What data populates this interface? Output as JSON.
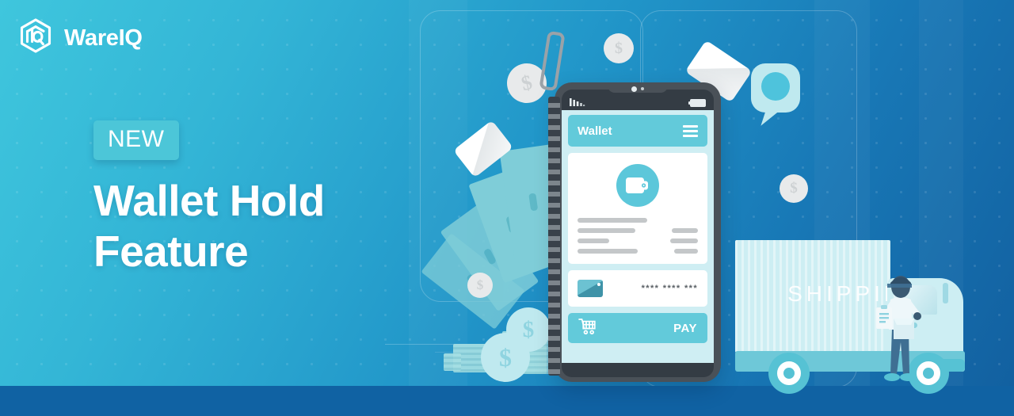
{
  "brand": {
    "name": "WareIQ",
    "logo_icon": "cube-hexagon-logo-icon"
  },
  "hero": {
    "badge": "NEW",
    "title_line1": "Wallet Hold",
    "title_line2": "Feature"
  },
  "phone": {
    "status": {
      "signal_icon": "signal-bars-icon",
      "battery_icon": "battery-icon",
      "camera_icon": "front-camera-icon"
    },
    "app_header": {
      "title": "Wallet",
      "menu_icon": "hamburger-menu-icon"
    },
    "wallet_icon": "wallet-icon",
    "card_row": {
      "card_icon": "credit-card-icon",
      "masked_number": "**** **** ***"
    },
    "pay_bar": {
      "cart_icon": "shopping-cart-icon",
      "label": "PAY"
    }
  },
  "illustration": {
    "truck": {
      "container_label": "SHIPPING",
      "courier_icon": "delivery-person-icon",
      "clipboard_icon": "clipboard-icon",
      "parcel_icon": "package-box-icon",
      "wheel_icon": "wheel-icon"
    },
    "coins": [
      {
        "symbol": "$",
        "tone": "grey"
      },
      {
        "symbol": "$",
        "tone": "grey"
      },
      {
        "symbol": "$",
        "tone": "grey"
      },
      {
        "symbol": "$",
        "tone": "grey"
      },
      {
        "symbol": "$",
        "tone": "teal"
      },
      {
        "symbol": "$",
        "tone": "teal"
      }
    ],
    "banknote_icon": "banknote-icon",
    "plastic_card_icon": "plastic-card-icon",
    "speech_bubble_icon": "speech-bubble-icon",
    "zipper_icon": "zipper-icon"
  },
  "colors": {
    "bg_start": "#3fc6dd",
    "bg_end": "#125f9f",
    "accent_teal": "#62cada",
    "badge_bg": "#4cc6d8",
    "phone_body": "#4a5158",
    "phone_bar": "#343c44",
    "screen_bg": "#cfeef3",
    "truck_light": "#cdeef3",
    "truck_mid": "#6ec8d8",
    "white": "#ffffff"
  }
}
